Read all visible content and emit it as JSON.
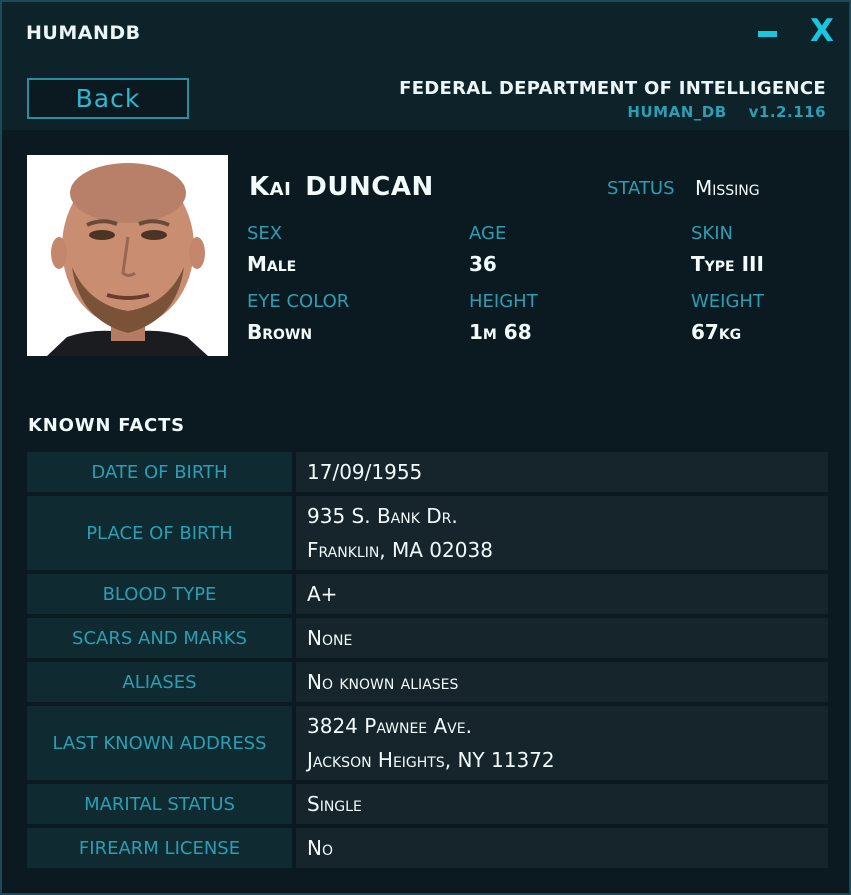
{
  "window": {
    "title": "HUMANDB",
    "minimize_symbol": "",
    "close_symbol": "X"
  },
  "header": {
    "back_label": "Back",
    "agency": "FEDERAL DEPARTMENT OF INTELLIGENCE",
    "db_name": "HUMAN_DB",
    "version": "v1.2.116"
  },
  "profile": {
    "first_name": "Kai",
    "last_name": "DUNCAN",
    "status_label": "STATUS",
    "status": "Missing",
    "attributes": {
      "sex_label": "SEX",
      "sex": "Male",
      "age_label": "AGE",
      "age": "36",
      "skin_label": "SKIN",
      "skin": "Type III",
      "eye_label": "EYE COLOR",
      "eye": "Brown",
      "height_label": "HEIGHT",
      "height": "1m 68",
      "weight_label": "WEIGHT",
      "weight": "67kg"
    }
  },
  "facts": {
    "title": "KNOWN FACTS",
    "rows": [
      {
        "key": "DATE OF BIRTH",
        "lines": [
          "17/09/1955"
        ]
      },
      {
        "key": "PLACE OF BIRTH",
        "lines": [
          "935 S. Bank Dr.",
          "Franklin, MA 02038"
        ]
      },
      {
        "key": "BLOOD TYPE",
        "lines": [
          "A+"
        ]
      },
      {
        "key": "SCARS AND MARKS",
        "lines": [
          "None"
        ]
      },
      {
        "key": "ALIASES",
        "lines": [
          "No known aliases"
        ]
      },
      {
        "key": "LAST KNOWN ADDRESS",
        "lines": [
          "3824 Pawnee Ave.",
          "Jackson Heights, NY 11372"
        ]
      },
      {
        "key": "MARITAL STATUS",
        "lines": [
          "Single"
        ]
      },
      {
        "key": "FIREARM LICENSE",
        "lines": [
          "No"
        ]
      }
    ]
  },
  "colors": {
    "accent": "#19c6de",
    "label": "#2a9fb4",
    "text": "#f2fbfc",
    "background": "#0a1a20"
  }
}
